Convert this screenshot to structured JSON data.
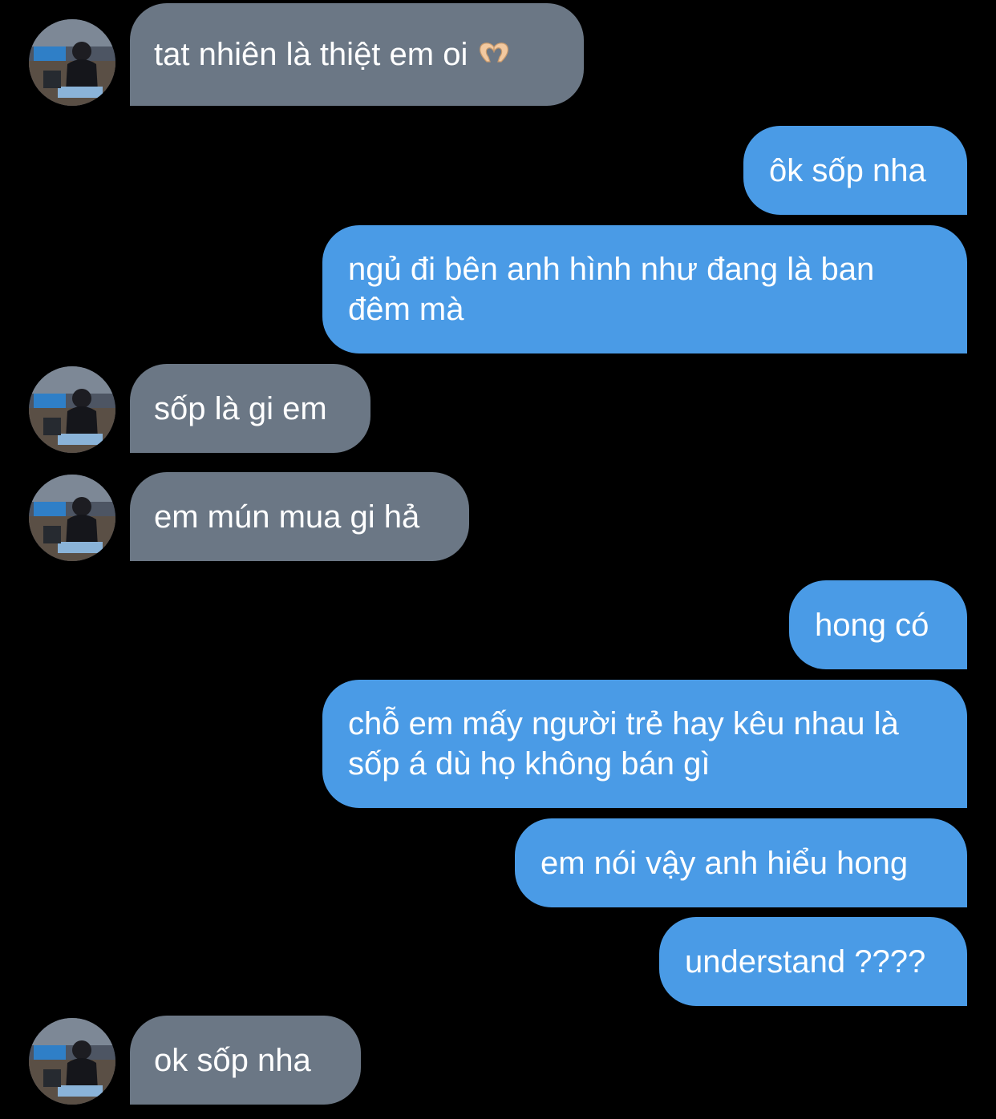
{
  "conversation": {
    "messages": [
      {
        "side": "incoming",
        "text": "tat nhiên là thiệt em oi",
        "emoji": "heart-hands-icon"
      },
      {
        "side": "outgoing",
        "text": "ôk sốp nha"
      },
      {
        "side": "outgoing",
        "text": "ngủ đi bên anh hình như đang là ban đêm mà"
      },
      {
        "side": "incoming",
        "text": "sốp là gi em"
      },
      {
        "side": "incoming",
        "text": "em mún mua gi hả"
      },
      {
        "side": "outgoing",
        "text": "hong có"
      },
      {
        "side": "outgoing",
        "text": "chỗ em mấy người trẻ hay kêu nhau là sốp á dù họ không bán gì"
      },
      {
        "side": "outgoing",
        "text": "em nói vậy anh hiểu hong"
      },
      {
        "side": "outgoing",
        "text": "understand ????"
      },
      {
        "side": "incoming",
        "text": "ok sốp nha"
      }
    ]
  },
  "colors": {
    "background": "#000000",
    "incoming_bubble": "#6b7785",
    "outgoing_bubble": "#4a9be6",
    "text": "#ffffff"
  }
}
